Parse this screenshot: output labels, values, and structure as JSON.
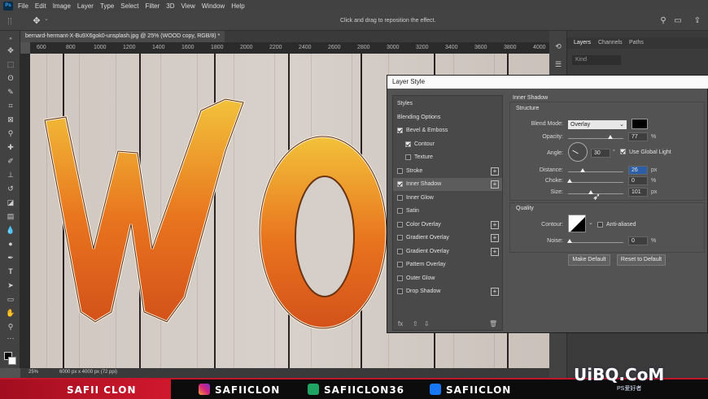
{
  "menubar": {
    "app_icon": "Ps",
    "items": [
      "File",
      "Edit",
      "Image",
      "Layer",
      "Type",
      "Select",
      "Filter",
      "3D",
      "View",
      "Window",
      "Help"
    ]
  },
  "options": {
    "hint": "Click and drag to reposition the effect."
  },
  "document": {
    "tab_title": "bernard-hermant-X-Bu9X6gok0-unsplash.jpg @ 25% (WOOD copy, RGB/8) *",
    "ruler_labels": [
      "600",
      "800",
      "1000",
      "1200",
      "1400",
      "1600",
      "1800",
      "2000",
      "2200",
      "2400",
      "2600",
      "2800",
      "3000",
      "3200",
      "3400",
      "3600",
      "3800",
      "4000"
    ],
    "zoom": "25%",
    "size": "6000 px x 4000 px (72 ppi)"
  },
  "panels": {
    "tabs": [
      "Layers",
      "Channels",
      "Paths"
    ],
    "kind_placeholder": "Kind"
  },
  "dialog": {
    "title": "Layer Style",
    "styles": [
      {
        "label": "Styles",
        "checkbox": false,
        "checked": false,
        "plus": false
      },
      {
        "label": "Blending Options",
        "checkbox": false,
        "checked": false,
        "plus": false
      },
      {
        "label": "Bevel & Emboss",
        "checkbox": true,
        "checked": true,
        "plus": false
      },
      {
        "label": "Contour",
        "checkbox": true,
        "checked": true,
        "plus": false,
        "indent": true
      },
      {
        "label": "Texture",
        "checkbox": true,
        "checked": false,
        "plus": false,
        "indent": true
      },
      {
        "label": "Stroke",
        "checkbox": true,
        "checked": false,
        "plus": true
      },
      {
        "label": "Inner Shadow",
        "checkbox": true,
        "checked": true,
        "plus": true,
        "selected": true
      },
      {
        "label": "Inner Glow",
        "checkbox": true,
        "checked": false,
        "plus": false
      },
      {
        "label": "Satin",
        "checkbox": true,
        "checked": false,
        "plus": false
      },
      {
        "label": "Color Overlay",
        "checkbox": true,
        "checked": false,
        "plus": true
      },
      {
        "label": "Gradient Overlay",
        "checkbox": true,
        "checked": false,
        "plus": true
      },
      {
        "label": "Gradient Overlay",
        "checkbox": true,
        "checked": false,
        "plus": true
      },
      {
        "label": "Pattern Overlay",
        "checkbox": true,
        "checked": false,
        "plus": false
      },
      {
        "label": "Outer Glow",
        "checkbox": true,
        "checked": false,
        "plus": false
      },
      {
        "label": "Drop Shadow",
        "checkbox": true,
        "checked": false,
        "plus": true
      }
    ],
    "fx_label": "fx",
    "inner_shadow": {
      "heading": "Inner Shadow",
      "structure": "Structure",
      "blend_mode_label": "Blend Mode:",
      "blend_mode": "Overlay",
      "color": "#000000",
      "opacity_label": "Opacity:",
      "opacity": "77",
      "opacity_level": 0.77,
      "angle_label": "Angle:",
      "angle": "30",
      "angle_unit": "°",
      "use_global_light": "Use Global Light",
      "use_global_light_checked": true,
      "distance_label": "Distance:",
      "distance": "26",
      "distance_level": 0.26,
      "choke_label": "Choke:",
      "choke": "0",
      "size_label": "Size:",
      "size": "101",
      "size_level": 0.41,
      "quality": "Quality",
      "contour_label": "Contour:",
      "anti_aliased": "Anti-aliased",
      "noise_label": "Noise:",
      "noise": "0",
      "percent": "%",
      "px": "px",
      "make_default": "Make Default",
      "reset_default": "Reset to Default"
    }
  },
  "banner": {
    "name": "SAFII CLON",
    "instagram": "SAFIICLON",
    "other": "SAFIICLON36",
    "facebook": "SAFIICLON",
    "watermark": "UiBQ.CoM",
    "watermark_sub": "PS爱好者"
  },
  "colors": {
    "accent_red": "#c3162b",
    "selection_blue": "#2d5ea8",
    "letter_orange": "#e8731e"
  }
}
